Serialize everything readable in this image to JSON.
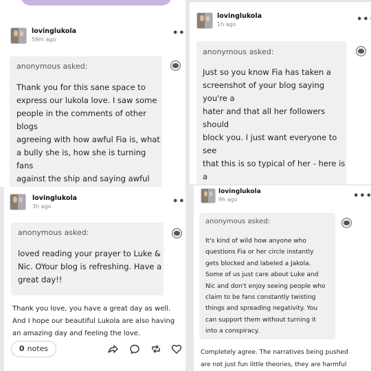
{
  "posts": [
    {
      "username": "lovinglukola",
      "time": "59m ago",
      "asker": "anonymous asked:",
      "ask_text": "Thank you for this sane space to\nexpress our lukola love. I saw some\npeople in the comments of other  blogs\nagreeing with how awful Fia is, what\na bully she is, how she is turning fans\nagainst the ship and saying awful\nthings about Nicola. I totally agree, but\nit's hard to say these things openly,\nbecause she is in the comments being"
    },
    {
      "username": "lovinglukola",
      "time": "1h ago",
      "asker": "anonymous asked:",
      "ask_text": "Just so you know Fia has taken a\nscreenshot of your blog saying you're a\nhater and that all her followers should\nblock you. I just want everyone to see\nthat this is so typical of her - here is a\nlukola blog that's asking for kindness\nand empathy for all involved in the\nship that we love. But her reaction\nis to be nasty and bully people and\ndemand that her followers block"
    },
    {
      "username": "lovinglukola",
      "time": "3h ago",
      "asker": "anonymous asked:",
      "ask_text": "loved reading your prayer to Luke &\nNic. OYour blog is refreshing. Have a\ngreat day!!",
      "answer": "Thank you love, you have a great day as well.\nAnd I hope our beautiful Lukola are also having\nan amazing day and feeling the love.",
      "notes_count": "0",
      "notes_label": "notes"
    },
    {
      "username": "lovinglukola",
      "time": "9h ago",
      "asker": "anonymous asked:",
      "ask_text": "It's kind of wild how anyone who\nquestions Fia or her circle instantly\ngets blocked and labeled a Jakola.\nSome of us just care about Luke and\nNic and don't enjoy seeing people who\nclaim to be fans constantly twisting\nthings and spreading negativity. You\ncan support them without turning it\ninto a conspiracy.",
      "answer": "Completely agree. The narratives being pushed\nare not just fun little theories, they are harmful\nto Luke and to the fandom."
    }
  ],
  "icons": {
    "more": "more-options-icon",
    "anon": "anonymous-avatar-icon",
    "share": "share-icon",
    "reply": "reply-icon",
    "reblog": "reblog-icon",
    "like": "heart-icon"
  },
  "colors": {
    "ask_bg": "#f0f0f0",
    "top_pill": "#c9b3e0"
  }
}
